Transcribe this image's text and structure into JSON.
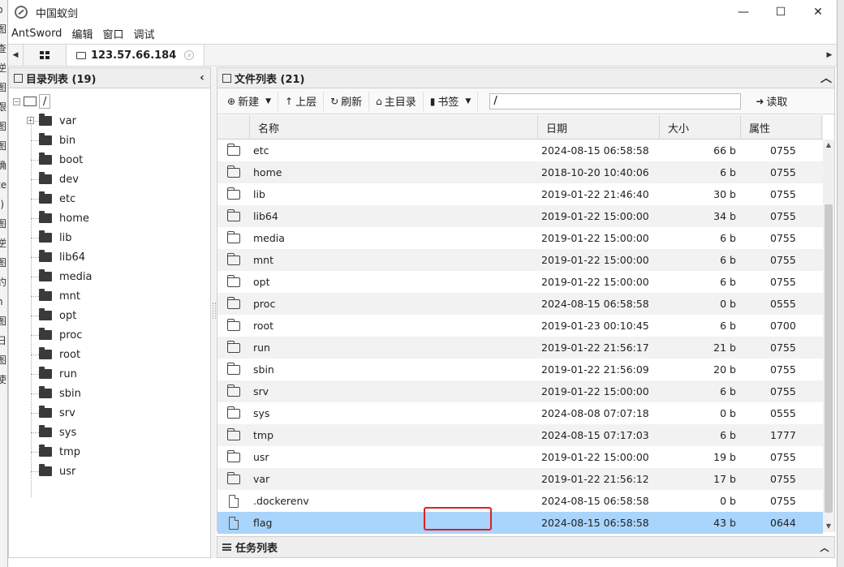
{
  "window": {
    "title": "中国蚁剑",
    "minimize": "—",
    "maximize": "☐",
    "close": "✕"
  },
  "menu": [
    "AntSword",
    "编辑",
    "窗口",
    "调试"
  ],
  "tabs": {
    "left_arrow": "◀",
    "right_arrow": "▶",
    "active_label": "123.57.66.184",
    "close": "✕"
  },
  "left_pane": {
    "title": "目录列表 (19)",
    "collapse": "‹",
    "root": "/",
    "items": [
      "var",
      "bin",
      "boot",
      "dev",
      "etc",
      "home",
      "lib",
      "lib64",
      "media",
      "mnt",
      "opt",
      "proc",
      "root",
      "run",
      "sbin",
      "srv",
      "sys",
      "tmp",
      "usr"
    ]
  },
  "right_pane": {
    "title": "文件列表 (21)",
    "collapse": "︿",
    "toolbar": {
      "new": "新建",
      "up": "上层",
      "refresh": "刷新",
      "home": "主目录",
      "bookmark": "书签",
      "path": "/",
      "read": "读取"
    },
    "columns": {
      "name": "名称",
      "date": "日期",
      "size": "大小",
      "attr": "属性"
    },
    "rows": [
      {
        "type": "folder",
        "name": "etc",
        "date": "2024-08-15 06:58:58",
        "size": "66 b",
        "attr": "0755"
      },
      {
        "type": "folder",
        "name": "home",
        "date": "2018-10-20 10:40:06",
        "size": "6 b",
        "attr": "0755"
      },
      {
        "type": "folder",
        "name": "lib",
        "date": "2019-01-22 21:46:40",
        "size": "30 b",
        "attr": "0755"
      },
      {
        "type": "folder",
        "name": "lib64",
        "date": "2019-01-22 15:00:00",
        "size": "34 b",
        "attr": "0755"
      },
      {
        "type": "folder",
        "name": "media",
        "date": "2019-01-22 15:00:00",
        "size": "6 b",
        "attr": "0755"
      },
      {
        "type": "folder",
        "name": "mnt",
        "date": "2019-01-22 15:00:00",
        "size": "6 b",
        "attr": "0755"
      },
      {
        "type": "folder",
        "name": "opt",
        "date": "2019-01-22 15:00:00",
        "size": "6 b",
        "attr": "0755"
      },
      {
        "type": "folder",
        "name": "proc",
        "date": "2024-08-15 06:58:58",
        "size": "0 b",
        "attr": "0555"
      },
      {
        "type": "folder",
        "name": "root",
        "date": "2019-01-23 00:10:45",
        "size": "6 b",
        "attr": "0700"
      },
      {
        "type": "folder",
        "name": "run",
        "date": "2019-01-22 21:56:17",
        "size": "21 b",
        "attr": "0755"
      },
      {
        "type": "folder",
        "name": "sbin",
        "date": "2019-01-22 21:56:09",
        "size": "20 b",
        "attr": "0755"
      },
      {
        "type": "folder",
        "name": "srv",
        "date": "2019-01-22 15:00:00",
        "size": "6 b",
        "attr": "0755"
      },
      {
        "type": "folder",
        "name": "sys",
        "date": "2024-08-08 07:07:18",
        "size": "0 b",
        "attr": "0555"
      },
      {
        "type": "folder",
        "name": "tmp",
        "date": "2024-08-15 07:17:03",
        "size": "6 b",
        "attr": "1777"
      },
      {
        "type": "folder",
        "name": "usr",
        "date": "2019-01-22 15:00:00",
        "size": "19 b",
        "attr": "0755"
      },
      {
        "type": "folder",
        "name": "var",
        "date": "2019-01-22 21:56:12",
        "size": "17 b",
        "attr": "0755"
      },
      {
        "type": "file",
        "name": ".dockerenv",
        "date": "2024-08-15 06:58:58",
        "size": "0 b",
        "attr": "0755"
      },
      {
        "type": "file",
        "name": "flag",
        "date": "2024-08-15 06:58:58",
        "size": "43 b",
        "attr": "0644",
        "selected": true
      }
    ]
  },
  "task_pane": {
    "title": "任务列表",
    "expand": "︿"
  },
  "colors": {
    "selection": "#a9d4fb",
    "highlight": "#e02020",
    "header_bg": "#eeeeee"
  }
}
